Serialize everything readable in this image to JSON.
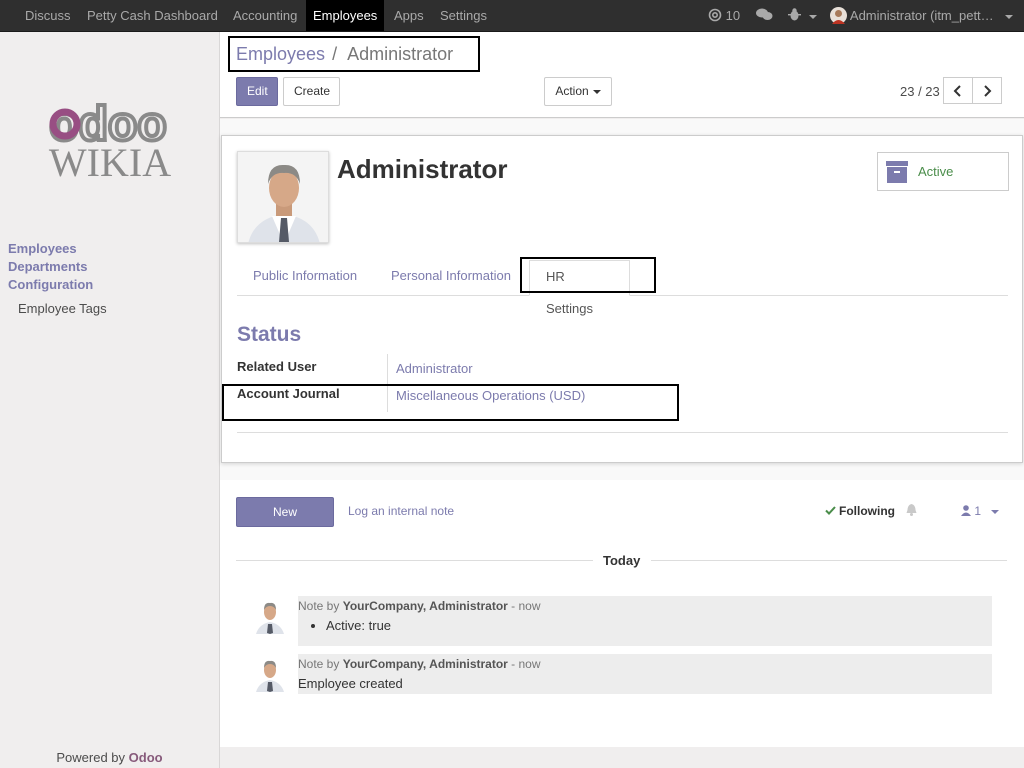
{
  "navbar": {
    "items": [
      {
        "label": "Discuss"
      },
      {
        "label": "Petty Cash Dashboard"
      },
      {
        "label": "Accounting"
      },
      {
        "label": "Employees",
        "active": true
      },
      {
        "label": "Apps"
      },
      {
        "label": "Settings"
      }
    ],
    "mentions_count": "10",
    "user_label": "Administrator (itm_pett…"
  },
  "sidebar": {
    "menus": [
      {
        "label": "Employees"
      },
      {
        "label": "Departments"
      },
      {
        "label": "Configuration"
      }
    ],
    "submenu": {
      "label": "Employee Tags"
    },
    "powered_by": "Powered by",
    "powered_brand": "Odoo",
    "logo_text_top": "odoo",
    "logo_text_bottom": "WIKIA"
  },
  "control_panel": {
    "breadcrumb_parent": "Employees",
    "breadcrumb_sep": "/",
    "breadcrumb_current": "Administrator",
    "edit_label": "Edit",
    "create_label": "Create",
    "action_label": "Action",
    "pager": "23 / 23"
  },
  "form": {
    "name": "Administrator",
    "active_label": "Active",
    "tabs": [
      {
        "label": "Public Information"
      },
      {
        "label": "Personal Information"
      },
      {
        "label": "HR Settings",
        "active": true
      }
    ],
    "section_title": "Status",
    "fields": [
      {
        "label": "Related User",
        "value": "Administrator"
      },
      {
        "label": "Account Journal",
        "value": "Miscellaneous Operations (USD)"
      }
    ]
  },
  "chatter": {
    "new_message_label": "New message",
    "log_note_label": "Log an internal note",
    "following_label": "Following",
    "followers_count": "1",
    "date_separator": "Today",
    "messages": [
      {
        "prefix": "Note by",
        "author": "YourCompany, Administrator",
        "time": "- now",
        "body_bullet": "Active: true"
      },
      {
        "prefix": "Note by",
        "author": "YourCompany, Administrator",
        "time": "- now",
        "body": "Employee created"
      }
    ]
  },
  "colors": {
    "brand": "#7c7bad",
    "odoo_purple": "#875a7b",
    "navbar": "#2f2f2f",
    "active_green": "#4a8d4a"
  },
  "icons": [
    "at-icon",
    "chat-bubbles-icon",
    "bug-icon",
    "user-avatar-icon",
    "archive-icon",
    "chevron-left-icon",
    "chevron-right-icon",
    "check-icon",
    "bell-icon",
    "user-icon"
  ]
}
